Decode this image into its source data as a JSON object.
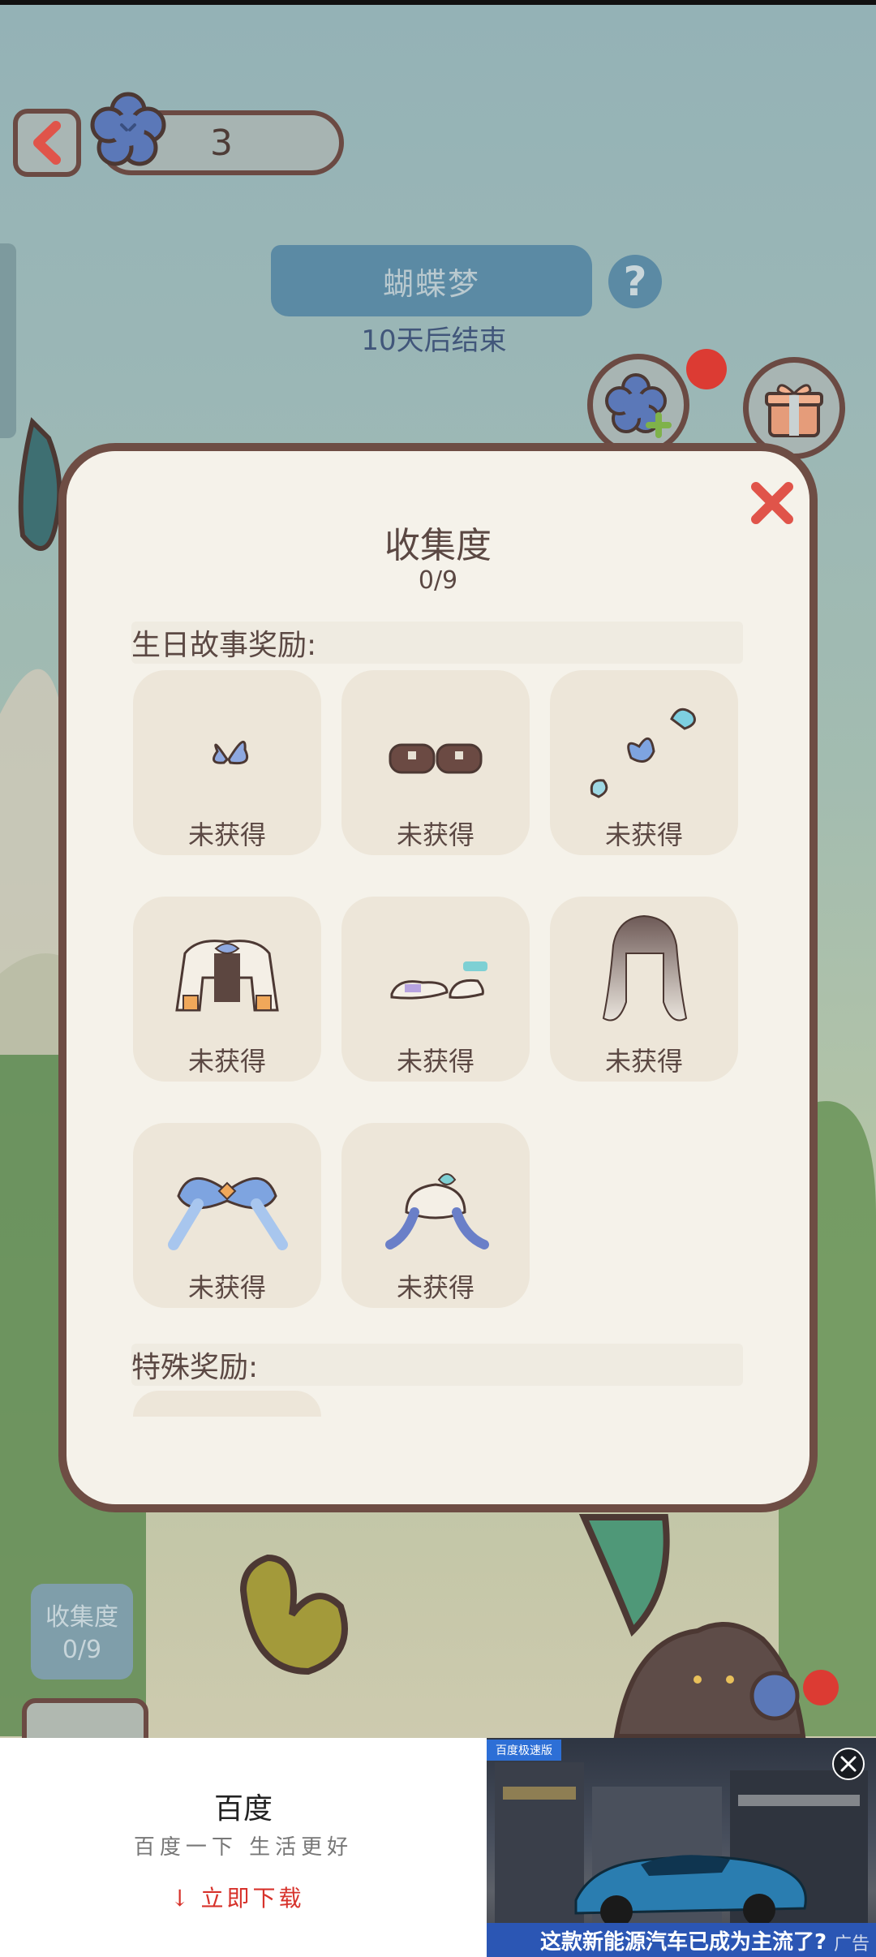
{
  "event": {
    "title": "蝴蝶梦",
    "time_left": "10天后结束",
    "help_glyph": "?"
  },
  "topbar": {
    "currency_count": "3",
    "back_glyph": "<"
  },
  "modal": {
    "title": "收集度",
    "progress": "0/9",
    "sections": [
      {
        "title": "生日故事奖励:",
        "items": [
          {
            "status": "未获得",
            "icon": "butterfly-hairpin-icon"
          },
          {
            "status": "未获得",
            "icon": "brown-shoes-icon"
          },
          {
            "status": "未获得",
            "icon": "butterfly-accessory-icon"
          },
          {
            "status": "未获得",
            "icon": "jacket-icon"
          },
          {
            "status": "未获得",
            "icon": "flat-shoes-icon"
          },
          {
            "status": "未获得",
            "icon": "gradient-hair-icon"
          },
          {
            "status": "未获得",
            "icon": "bow-sleeves-icon"
          },
          {
            "status": "未获得",
            "icon": "ribbon-top-icon"
          }
        ]
      },
      {
        "title": "特殊奖励:",
        "items": []
      }
    ]
  },
  "collection_badge": {
    "label": "收集度",
    "value": "0/9"
  },
  "ad": {
    "brand": "百度",
    "slogan": "百度一下 生活更好",
    "download": "立即下载",
    "tag": "百度极速版",
    "caption": "这款新能源汽车已成为主流了?",
    "caption_tail": "广告"
  },
  "colors": {
    "modal_border": "#6e4d44",
    "card_bg": "#ede6d9",
    "banner_blue": "#5b8aa4",
    "close_red": "#e0544a"
  }
}
